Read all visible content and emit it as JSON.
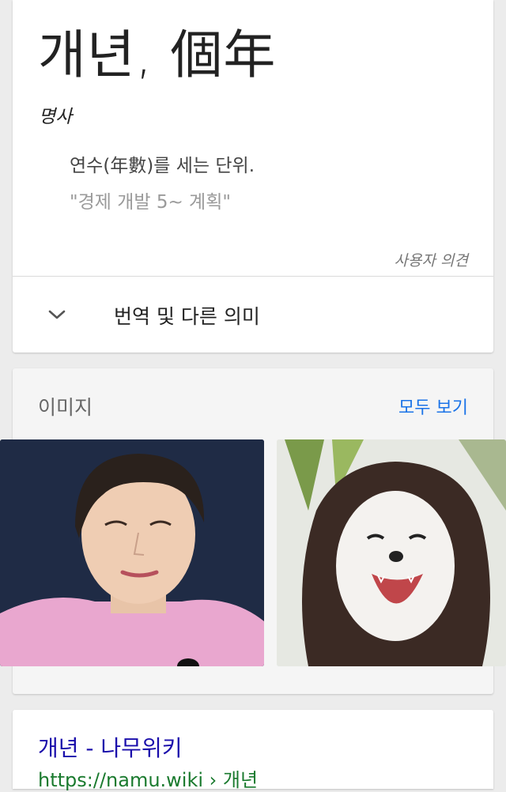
{
  "dictionary": {
    "headword": "개년, 個年",
    "part_of_speech": "명사",
    "definition": "연수(年數)를 세는 단위.",
    "example": "\"경제 개발 5~ 계획\"",
    "feedback_label": "사용자 의견",
    "translate_label": "번역 및 다른 의미",
    "translate_icon": "chevron-down-icon"
  },
  "images": {
    "title": "이미지",
    "see_all": "모두 보기",
    "thumbnails": [
      {
        "subject": "woman-portrait-photo"
      },
      {
        "subject": "dog-with-wig-photo"
      }
    ]
  },
  "result": {
    "title": "개년 - 나무위키",
    "url": "https://namu.wiki › 개년"
  },
  "colors": {
    "link_blue": "#1a73e8",
    "result_title": "#1a0dab",
    "result_url": "#1a7a2e"
  }
}
